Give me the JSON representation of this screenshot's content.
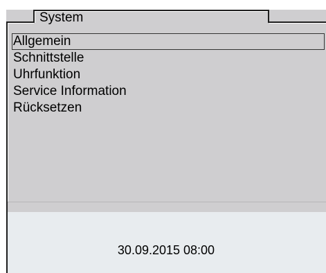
{
  "header": {
    "title": "System"
  },
  "menu": {
    "items": [
      {
        "label": "Allgemein",
        "selected": true
      },
      {
        "label": "Schnittstelle",
        "selected": false
      },
      {
        "label": "Uhrfunktion",
        "selected": false
      },
      {
        "label": "Service Information",
        "selected": false
      },
      {
        "label": "Rücksetzen",
        "selected": false
      }
    ]
  },
  "status": {
    "datetime": "30.09.2015 08:00"
  },
  "colors": {
    "panel_background": "#cfced0",
    "screen_background": "#e8ecef",
    "frame": "#1e1e1e"
  }
}
